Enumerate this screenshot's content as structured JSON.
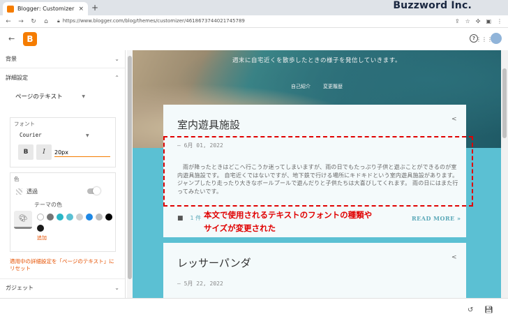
{
  "browser": {
    "tab_title": "Blogger: Customizer",
    "tab_close": "×",
    "new_tab": "+",
    "brand": "Buzzword Inc.",
    "window_controls": "–  ❐  ✕",
    "url": "https://www.blogger.com/blog/themes/customizer/4618673744021745789"
  },
  "header": {
    "logo": "B",
    "help": "?"
  },
  "sidebar": {
    "sections": [
      {
        "label": "背景"
      },
      {
        "label": "詳細設定"
      }
    ],
    "detail_dropdown": "ページのテキスト",
    "font_card": {
      "title": "フォント",
      "font_name": "Courier",
      "bold_label": "B",
      "italic_label": "I",
      "size_value": "20px"
    },
    "color_card": {
      "title": "色",
      "transparent_label": "透過",
      "theme_color_label": "テーマの色",
      "add_label": "追加",
      "swatches": [
        "#ffffff",
        "#757575",
        "#29b6c6",
        "#5bc0d3",
        "#cfcfcf",
        "#1e88e5",
        "#bdbdbd",
        "#000000",
        "#1a1a1a"
      ]
    },
    "applied_note": "適用中の詳細設定を「ページのテキスト」にリセット",
    "gadget_label": "ガジェット"
  },
  "preview": {
    "blog_description": "週末に自宅近くを散歩したときの様子を発信していきます。",
    "header_links": [
      "自己紹介",
      "変更履歴"
    ],
    "posts": [
      {
        "title": "室内遊具施設",
        "date": "– 6月 01, 2022",
        "body": "雨が降ったときはどこへ行こうか迷ってしまいますが、雨の日でもたっぷり子供と遊ぶことができるのが室内遊具施設です。 自宅近くではないですが、地下鉄で行ける場所にキドキドという室内遊具施設があります。ジャンプしたり走ったり大きなボールプールで遊んだりと子供たちは大喜びしてくれます。 雨の日にはまた行ってみたいです。",
        "comment_count": "1 件",
        "read_more": "READ MORE »"
      },
      {
        "title": "レッサーパンダ",
        "date": "– 5月 22, 2022"
      }
    ],
    "annotation": [
      "本文で使用されるテキストのフォントの種類や",
      "サイズが変更された"
    ]
  }
}
